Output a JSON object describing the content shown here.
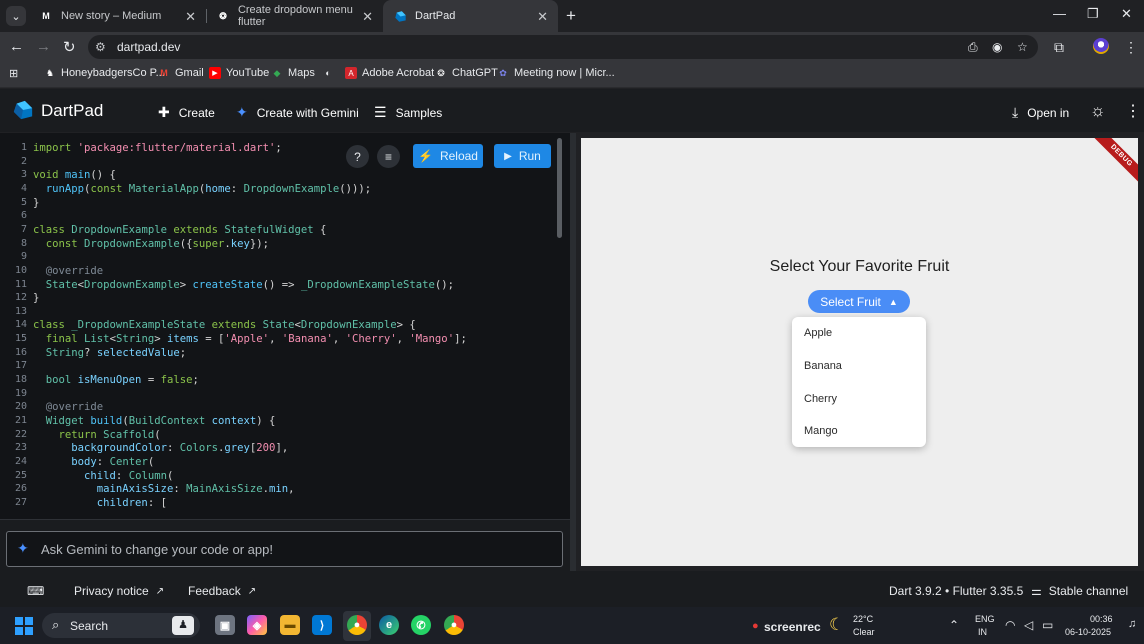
{
  "browser": {
    "tabs": [
      {
        "title": "New story – Medium",
        "favicon": "medium-icon",
        "active": false
      },
      {
        "title": "Create dropdown menu flutter",
        "favicon": "chatgpt-icon",
        "active": false
      },
      {
        "title": "DartPad",
        "favicon": "dartpad-icon",
        "active": true
      }
    ],
    "url": "dartpad.dev",
    "bookmarks": [
      {
        "label": "HoneybadgersCo P...",
        "icon": "honeybadger-icon"
      },
      {
        "label": "Gmail",
        "icon": "gmail-icon"
      },
      {
        "label": "YouTube",
        "icon": "youtube-icon"
      },
      {
        "label": "Maps",
        "icon": "maps-icon"
      },
      {
        "label": "",
        "icon": "globe-icon"
      },
      {
        "label": "Adobe Acrobat",
        "icon": "acrobat-icon"
      },
      {
        "label": "ChatGPT",
        "icon": "chatgpt-icon"
      },
      {
        "label": "Meeting now | Micr...",
        "icon": "teams-icon"
      }
    ]
  },
  "dartpad": {
    "title": "DartPad",
    "actions": {
      "create": "Create",
      "create_gemini": "Create with Gemini",
      "samples": "Samples",
      "open_in": "Open in"
    },
    "editor": {
      "reload": "Reload",
      "run": "Run"
    },
    "gemini_placeholder": "Ask Gemini to change your code or app!",
    "status": {
      "privacy": "Privacy notice",
      "feedback": "Feedback",
      "version": "Dart 3.9.2 • Flutter 3.35.5",
      "channel": "Stable channel"
    }
  },
  "code_lines": [
    [
      [
        "kw",
        "import "
      ],
      [
        "str",
        "'package:flutter/material.dart'"
      ],
      [
        "pun",
        ";"
      ]
    ],
    [],
    [
      [
        "kw",
        "void "
      ],
      [
        "fn",
        "main"
      ],
      [
        "pun",
        "() {"
      ]
    ],
    [
      [
        "pun",
        "  "
      ],
      [
        "fn",
        "runApp"
      ],
      [
        "pun",
        "("
      ],
      [
        "kw",
        "const "
      ],
      [
        "cls",
        "MaterialApp"
      ],
      [
        "pun",
        "("
      ],
      [
        "prop",
        "home"
      ],
      [
        "pun",
        ": "
      ],
      [
        "cls",
        "DropdownExample"
      ],
      [
        "pun",
        "()));"
      ]
    ],
    [
      [
        "pun",
        "}"
      ]
    ],
    [],
    [
      [
        "kw",
        "class "
      ],
      [
        "cls",
        "DropdownExample "
      ],
      [
        "kw",
        "extends "
      ],
      [
        "cls",
        "StatefulWidget "
      ],
      [
        "pun",
        "{"
      ]
    ],
    [
      [
        "pun",
        "  "
      ],
      [
        "kw",
        "const "
      ],
      [
        "cls",
        "DropdownExample"
      ],
      [
        "pun",
        "({"
      ],
      [
        "kw",
        "super"
      ],
      [
        "pun",
        "."
      ],
      [
        "prop",
        "key"
      ],
      [
        "pun",
        "});"
      ]
    ],
    [],
    [
      [
        "ann",
        "  @override"
      ]
    ],
    [
      [
        "pun",
        "  "
      ],
      [
        "cls",
        "State"
      ],
      [
        "pun",
        "<"
      ],
      [
        "cls",
        "DropdownExample"
      ],
      [
        "pun",
        "> "
      ],
      [
        "fn",
        "createState"
      ],
      [
        "pun",
        "() => "
      ],
      [
        "cls",
        "_DropdownExampleState"
      ],
      [
        "pun",
        "();"
      ]
    ],
    [
      [
        "pun",
        "}"
      ]
    ],
    [],
    [
      [
        "kw",
        "class "
      ],
      [
        "cls",
        "_DropdownExampleState "
      ],
      [
        "kw",
        "extends "
      ],
      [
        "cls",
        "State"
      ],
      [
        "pun",
        "<"
      ],
      [
        "cls",
        "DropdownExample"
      ],
      [
        "pun",
        "> {"
      ]
    ],
    [
      [
        "pun",
        "  "
      ],
      [
        "kw",
        "final "
      ],
      [
        "cls",
        "List"
      ],
      [
        "pun",
        "<"
      ],
      [
        "cls",
        "String"
      ],
      [
        "pun",
        "> "
      ],
      [
        "prop",
        "items"
      ],
      [
        "pun",
        " = ["
      ],
      [
        "str",
        "'Apple'"
      ],
      [
        "pun",
        ", "
      ],
      [
        "str",
        "'Banana'"
      ],
      [
        "pun",
        ", "
      ],
      [
        "str",
        "'Cherry'"
      ],
      [
        "pun",
        ", "
      ],
      [
        "str",
        "'Mango'"
      ],
      [
        "pun",
        "];"
      ]
    ],
    [
      [
        "pun",
        "  "
      ],
      [
        "cls",
        "String"
      ],
      [
        "pun",
        "? "
      ],
      [
        "prop",
        "selectedValue"
      ],
      [
        "pun",
        ";"
      ]
    ],
    [],
    [
      [
        "pun",
        "  "
      ],
      [
        "cls",
        "bool "
      ],
      [
        "prop",
        "isMenuOpen"
      ],
      [
        "pun",
        " = "
      ],
      [
        "kw",
        "false"
      ],
      [
        "pun",
        ";"
      ]
    ],
    [],
    [
      [
        "ann",
        "  @override"
      ]
    ],
    [
      [
        "pun",
        "  "
      ],
      [
        "cls",
        "Widget "
      ],
      [
        "fn",
        "build"
      ],
      [
        "pun",
        "("
      ],
      [
        "cls",
        "BuildContext "
      ],
      [
        "prop",
        "context"
      ],
      [
        "pun",
        ") {"
      ]
    ],
    [
      [
        "pun",
        "    "
      ],
      [
        "kw",
        "return "
      ],
      [
        "cls",
        "Scaffold"
      ],
      [
        "pun",
        "("
      ]
    ],
    [
      [
        "pun",
        "      "
      ],
      [
        "prop",
        "backgroundColor"
      ],
      [
        "pun",
        ": "
      ],
      [
        "cls",
        "Colors"
      ],
      [
        "pun",
        "."
      ],
      [
        "prop",
        "grey"
      ],
      [
        "pun",
        "["
      ],
      [
        "str",
        "200"
      ],
      [
        "pun",
        "],"
      ]
    ],
    [
      [
        "pun",
        "      "
      ],
      [
        "prop",
        "body"
      ],
      [
        "pun",
        ": "
      ],
      [
        "cls",
        "Center"
      ],
      [
        "pun",
        "("
      ]
    ],
    [
      [
        "pun",
        "        "
      ],
      [
        "prop",
        "child"
      ],
      [
        "pun",
        ": "
      ],
      [
        "cls",
        "Column"
      ],
      [
        "pun",
        "("
      ]
    ],
    [
      [
        "pun",
        "          "
      ],
      [
        "prop",
        "mainAxisSize"
      ],
      [
        "pun",
        ": "
      ],
      [
        "cls",
        "MainAxisSize"
      ],
      [
        "pun",
        "."
      ],
      [
        "prop",
        "min"
      ],
      [
        "pun",
        ","
      ]
    ],
    [
      [
        "pun",
        "          "
      ],
      [
        "prop",
        "children"
      ],
      [
        "pun",
        ": ["
      ]
    ]
  ],
  "preview": {
    "debug_banner": "DEBUG",
    "heading": "Select Your Favorite Fruit",
    "button_label": "Select Fruit",
    "menu_items": [
      "Apple",
      "Banana",
      "Cherry",
      "Mango"
    ]
  },
  "taskbar": {
    "search": "Search",
    "screenrec": "screenrec",
    "weather_temp": "22°C",
    "weather_desc": "Clear",
    "lang1": "ENG",
    "lang2": "IN",
    "time": "00:36",
    "date": "06-10-2025"
  },
  "colors": {
    "accent": "#1e88e5",
    "preview_button": "#4a8df6",
    "debug": "#b71c1c"
  }
}
